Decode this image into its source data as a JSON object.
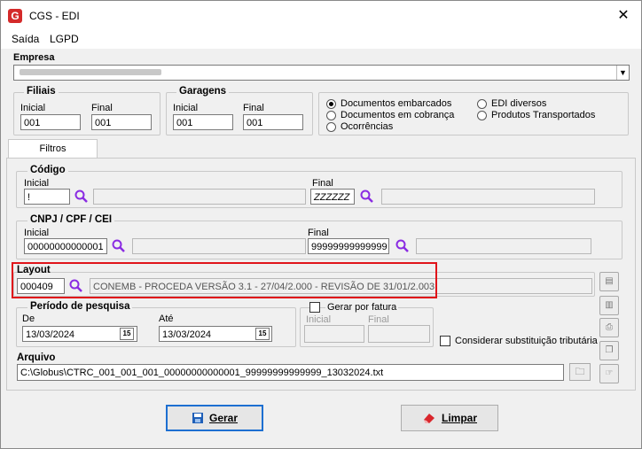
{
  "window": {
    "title": "CGS - EDI",
    "logo": "G",
    "close": "✕"
  },
  "menu": {
    "items": [
      "Saída",
      "LGPD"
    ]
  },
  "empresa": {
    "label": "Empresa",
    "value": ""
  },
  "filiais": {
    "title": "Filiais",
    "inicial_label": "Inicial",
    "inicial_value": "001",
    "final_label": "Final",
    "final_value": "001"
  },
  "garagens": {
    "title": "Garagens",
    "inicial_label": "Inicial",
    "inicial_value": "001",
    "final_label": "Final",
    "final_value": "001"
  },
  "doc_types": [
    {
      "label": "Documentos embarcados",
      "checked": true
    },
    {
      "label": "Documentos em cobrança",
      "checked": false
    },
    {
      "label": "Ocorrências",
      "checked": false
    },
    {
      "label": "EDI diversos",
      "checked": false
    },
    {
      "label": "Produtos Transportados",
      "checked": false
    }
  ],
  "tabs": {
    "filtros": "Filtros"
  },
  "codigo": {
    "title": "Código",
    "inicial_label": "Inicial",
    "inicial_value": "!",
    "final_label": "Final",
    "final_value": "ZZZZZZ"
  },
  "cnpj": {
    "title": "CNPJ / CPF / CEI",
    "inicial_label": "Inicial",
    "inicial_value": "00000000000001",
    "final_label": "Final",
    "final_value": "99999999999999"
  },
  "layout": {
    "title": "Layout",
    "code": "000409",
    "description": "CONEMB - PROCEDA VERSÃO 3.1 - 27/04/2.000 - REVISÃO DE 31/01/2.003"
  },
  "periodo": {
    "title": "Período de pesquisa",
    "de_label": "De",
    "de_value": "13/03/2024",
    "ate_label": "Até",
    "ate_value": "13/03/2024",
    "cal_glyph": "15"
  },
  "fatura": {
    "label": "Gerar por fatura",
    "inicial_label": "Inicial",
    "final_label": "Final"
  },
  "substituicao": {
    "label": "Considerar substituição tributária"
  },
  "arquivo": {
    "title": "Arquivo",
    "value": "C:\\Globus\\CTRC_001_001_001_00000000000001_99999999999999_13032024.txt"
  },
  "buttons": {
    "gerar": "Gerar",
    "limpar": "Limpar"
  },
  "colors": {
    "highlight": "#e0141a",
    "search_icon": "#8a2be2",
    "default_button": "#1d6fd1"
  }
}
